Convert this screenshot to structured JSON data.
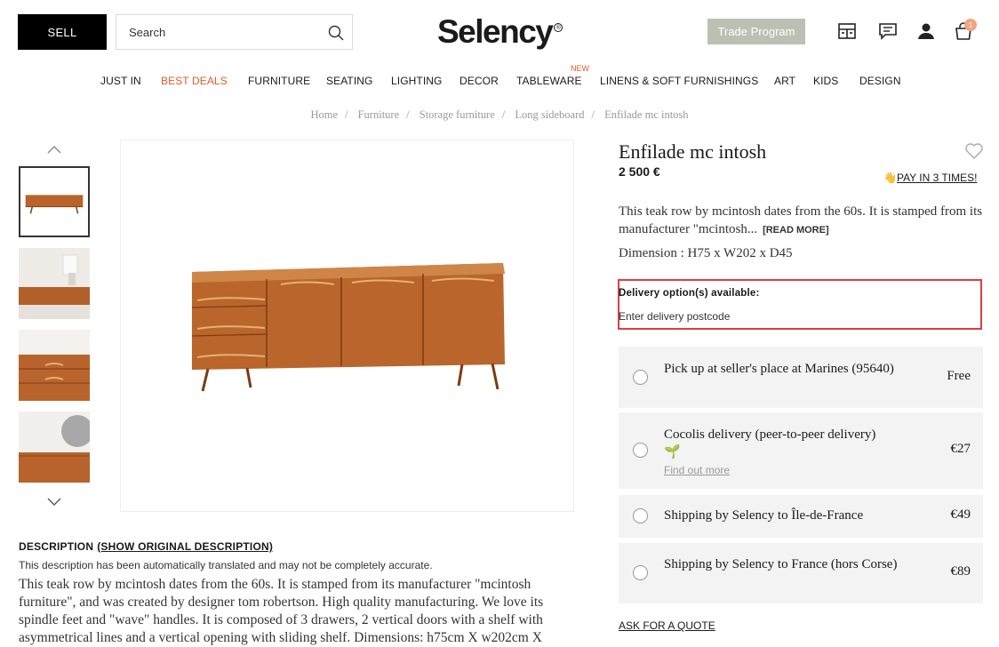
{
  "header": {
    "sell_label": "SELL",
    "search_placeholder": "Search",
    "logo_text": "Selency",
    "logo_mark": "®",
    "trade_label": "Trade Program",
    "cart_count": "1",
    "icons": [
      "search-icon",
      "store-icon",
      "chat-icon",
      "account-icon",
      "cart-icon"
    ]
  },
  "nav": {
    "new_badge": "NEW",
    "items": [
      "JUST IN",
      "BEST DEALS",
      "FURNITURE",
      "SEATING",
      "LIGHTING",
      "DECOR",
      "TABLEWARE",
      "LINENS & SOFT FURNISHINGS",
      "ART",
      "KIDS",
      "DESIGN"
    ]
  },
  "breadcrumb": {
    "items": [
      "Home",
      "Furniture",
      "Storage furniture",
      "Long sideboard",
      "Enfilade mc intosh"
    ],
    "separator": "/"
  },
  "product": {
    "title": "Enfilade mc intosh",
    "price": "2 500 €",
    "pay_emoji": "👋",
    "pay_link": "PAY IN 3 TIMES!",
    "short_desc": "This teak row by mcintosh dates from the 60s. It is stamped from its manufacturer \"mcintosh...",
    "read_more": "[READ MORE]",
    "dimension": "Dimension : H75 x W202 x D45"
  },
  "delivery": {
    "label": "Delivery option(s) available:",
    "postcode_placeholder": "Enter delivery postcode",
    "options": [
      {
        "text": "Pick up at seller's place at Marines (95640)",
        "price": "Free"
      },
      {
        "text": "Cocolis delivery (peer-to-peer delivery)",
        "emoji": "🌱",
        "link": "Find out more",
        "price": "€27"
      },
      {
        "text": "Shipping by Selency to Île-de-France",
        "price": "€49"
      },
      {
        "text": "Shipping by Selency to France (hors Corse)",
        "price": "€89"
      }
    ],
    "quote_link": "ASK FOR A QUOTE"
  },
  "description": {
    "heading": "DESCRIPTION",
    "toggle": "(SHOW ORIGINAL DESCRIPTION)",
    "note": "This description has been automatically translated and may not be completely accurate.",
    "body": "This teak row by mcintosh dates from the 60s. It is stamped from its manufacturer \"mcintosh furniture\", and was created by designer tom robertson. High quality manufacturing. We love its spindle feet and \"wave\" handles. It is composed of 3 drawers, 2 vertical doors with a shelf with asymmetrical lines and a vertical opening with sliding shelf. Dimensions: h75cm X w202cm X"
  },
  "colors": {
    "accent": "#e65a2c",
    "trade_button": "#bcc0b3",
    "delivery_border": "#d94040",
    "option_bg": "#f3f3f3",
    "teak": "#b8632b"
  }
}
